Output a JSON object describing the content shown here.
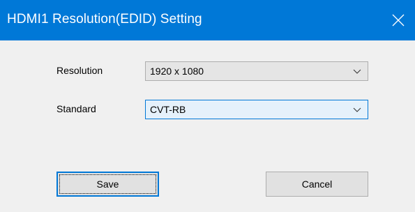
{
  "window": {
    "title": "HDMI1 Resolution(EDID) Setting",
    "close_icon": "close-icon",
    "title_bar_color": "#0078d7"
  },
  "form": {
    "resolution": {
      "label": "Resolution",
      "selected": "1920 x 1080"
    },
    "standard": {
      "label": "Standard",
      "selected": "CVT-RB"
    }
  },
  "buttons": {
    "save_label": "Save",
    "cancel_label": "Cancel"
  }
}
